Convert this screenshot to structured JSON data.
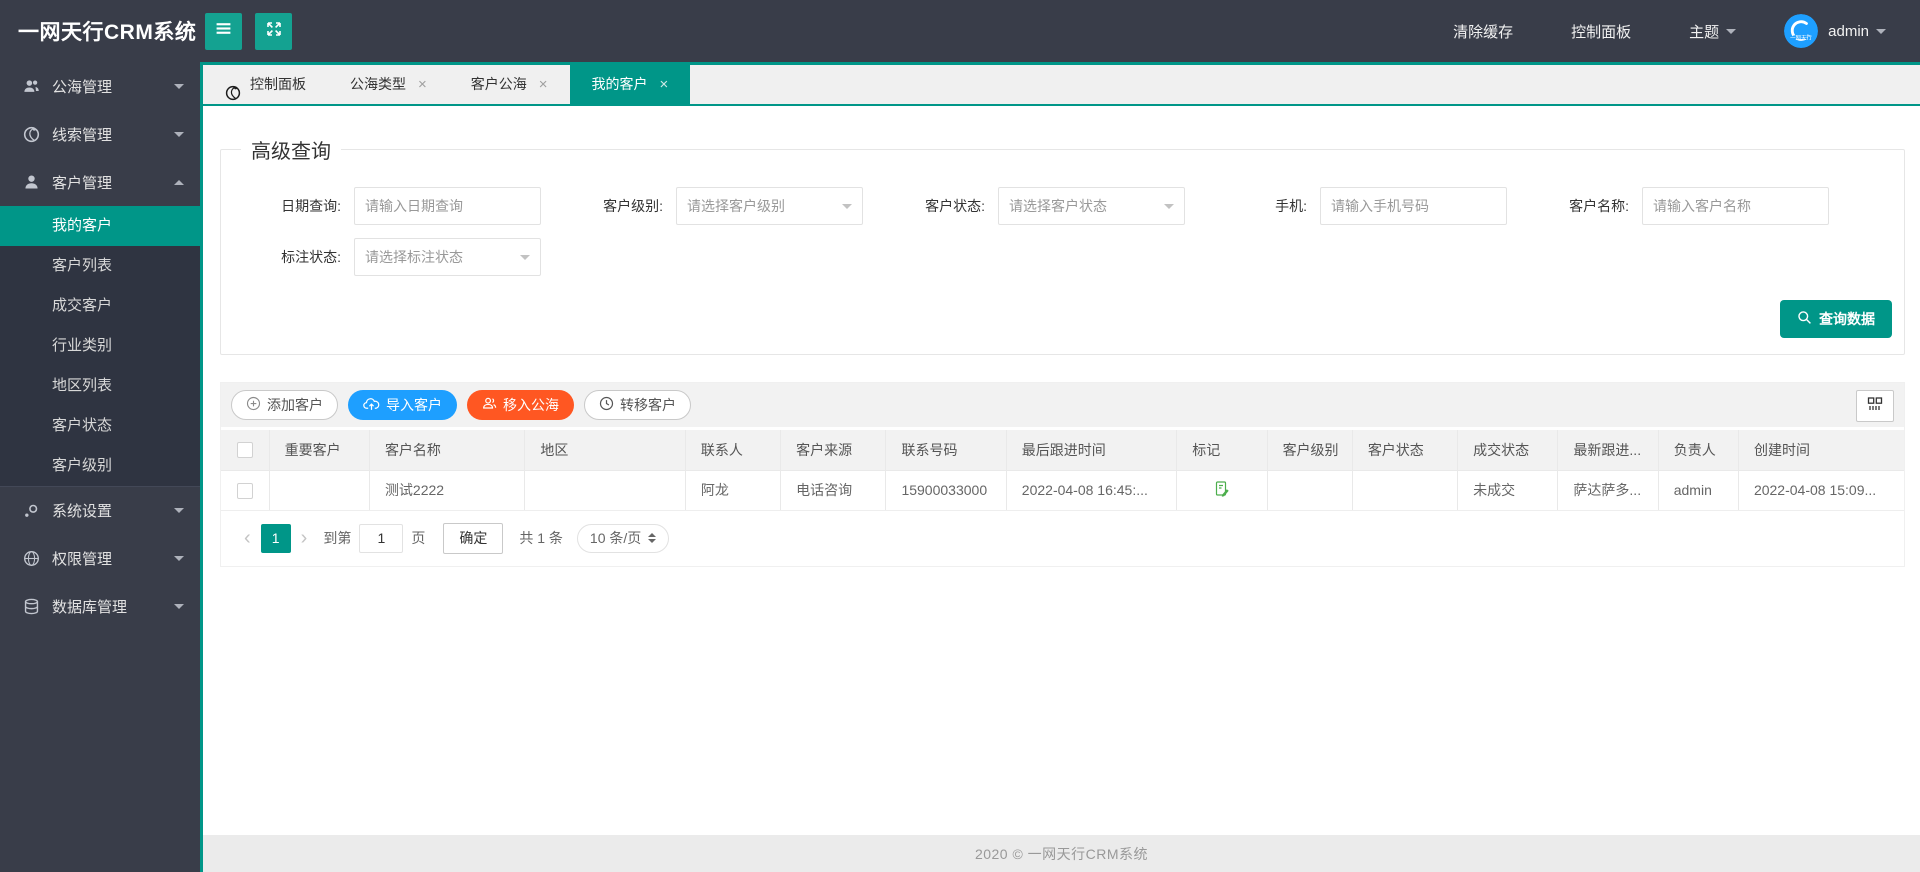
{
  "colors": {
    "accent": "#009688",
    "dark": "#393D49",
    "blue": "#1E9FFF",
    "orange": "#FF5722"
  },
  "header": {
    "logo": "一网天行CRM系统",
    "clear_cache": "清除缓存",
    "control_panel": "控制面板",
    "theme": "主题",
    "username": "admin"
  },
  "sidebar": {
    "items": [
      {
        "label": "公海管理",
        "icon": "users-icon"
      },
      {
        "label": "线索管理",
        "icon": "globe-icon"
      },
      {
        "label": "客户管理",
        "icon": "user-icon"
      },
      {
        "label": "系统设置",
        "icon": "settings-icon"
      },
      {
        "label": "权限管理",
        "icon": "network-icon"
      },
      {
        "label": "数据库管理",
        "icon": "database-icon"
      }
    ],
    "customer_children": [
      {
        "label": "我的客户",
        "active": true
      },
      {
        "label": "客户列表"
      },
      {
        "label": "成交客户"
      },
      {
        "label": "行业类别"
      },
      {
        "label": "地区列表"
      },
      {
        "label": "客户状态"
      },
      {
        "label": "客户级别"
      }
    ]
  },
  "tabs": [
    {
      "label": "控制面板",
      "icon": "globe-icon",
      "closable": false
    },
    {
      "label": "公海类型",
      "closable": true
    },
    {
      "label": "客户公海",
      "closable": true
    },
    {
      "label": "我的客户",
      "closable": true,
      "active": true
    }
  ],
  "query": {
    "legend": "高级查询",
    "date": {
      "label": "日期查询:",
      "placeholder": "请输入日期查询"
    },
    "level": {
      "label": "客户级别:",
      "placeholder": "请选择客户级别"
    },
    "status": {
      "label": "客户状态:",
      "placeholder": "请选择客户状态"
    },
    "phone": {
      "label": "手机:",
      "placeholder": "请输入手机号码"
    },
    "name": {
      "label": "客户名称:",
      "placeholder": "请输入客户名称"
    },
    "mark": {
      "label": "标注状态:",
      "placeholder": "请选择标注状态"
    },
    "submit": "查询数据"
  },
  "toolbar": {
    "add": "添加客户",
    "import": "导入客户",
    "move_to_sea": "移入公海",
    "transfer": "转移客户"
  },
  "table": {
    "columns": [
      "重要客户",
      "客户名称",
      "地区",
      "联系人",
      "客户来源",
      "联系号码",
      "最后跟进时间",
      "标记",
      "客户级别",
      "客户状态",
      "成交状态",
      "最新跟进...",
      "负责人",
      "创建时间"
    ],
    "rows": [
      {
        "important": "",
        "name": "测试2222",
        "region": "",
        "contact": "阿龙",
        "source": "电话咨询",
        "phone": "15900033000",
        "last_follow": "2022-04-08 16:45:...",
        "mark_icon": "green-note-icon",
        "level": "",
        "status": "",
        "deal_status": "未成交",
        "latest_follow": "萨达萨多...",
        "owner": "admin",
        "created": "2022-04-08 15:09..."
      }
    ]
  },
  "pagination": {
    "prev": "‹",
    "page": "1",
    "next": "›",
    "goto_prefix": "到第",
    "goto_value": "1",
    "goto_suffix": "页",
    "confirm": "确定",
    "total": "共 1 条",
    "page_size": "10 条/页"
  },
  "footer": "2020 ©   一网天行CRM系统"
}
